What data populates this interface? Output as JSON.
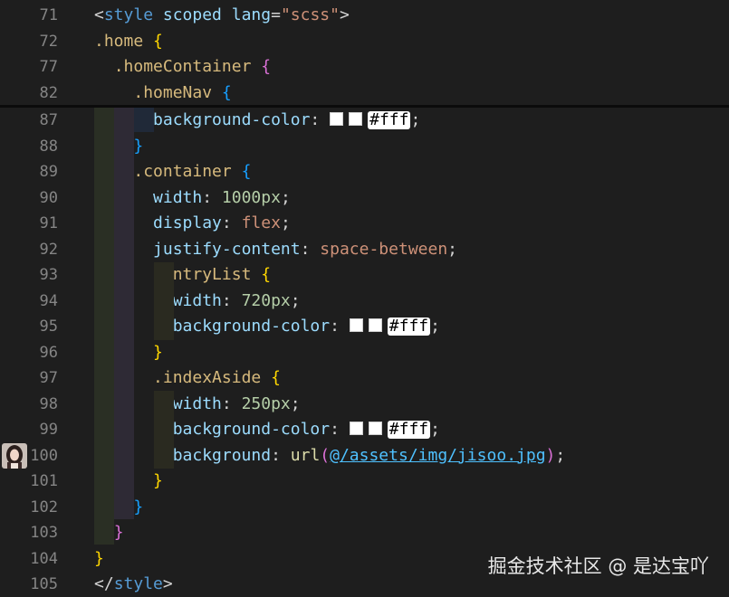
{
  "colors": {
    "background": "#1e1e1e",
    "line_number": "#858585",
    "tag": "#569cd6",
    "attribute": "#9cdcfe",
    "string": "#ce9178",
    "selector": "#d7ba7d",
    "brace_yellow": "#ffd700",
    "brace_purple": "#da70d6",
    "brace_blue": "#179fff",
    "number": "#b5cea8",
    "function": "#dcdcaa",
    "link": "#4fc1ff"
  },
  "sticky_scroll": {
    "lines": [
      {
        "number": "71",
        "segments": [
          {
            "text": "<",
            "cls": "punc"
          },
          {
            "text": "style",
            "cls": "tag"
          },
          {
            "text": " ",
            "cls": "punc"
          },
          {
            "text": "scoped",
            "cls": "attr"
          },
          {
            "text": " ",
            "cls": "punc"
          },
          {
            "text": "lang",
            "cls": "attr"
          },
          {
            "text": "=",
            "cls": "punc"
          },
          {
            "text": "\"scss\"",
            "cls": "str"
          },
          {
            "text": ">",
            "cls": "punc"
          }
        ]
      },
      {
        "number": "72",
        "segments": [
          {
            "text": ".home",
            "cls": "sel"
          },
          {
            "text": " ",
            "cls": "punc"
          },
          {
            "text": "{",
            "cls": "brace1"
          }
        ]
      },
      {
        "number": "77",
        "segments": [
          {
            "text": "  ",
            "cls": "punc"
          },
          {
            "text": ".homeContainer",
            "cls": "sel"
          },
          {
            "text": " ",
            "cls": "punc"
          },
          {
            "text": "{",
            "cls": "brace2"
          }
        ]
      },
      {
        "number": "82",
        "segments": [
          {
            "text": "    ",
            "cls": "punc"
          },
          {
            "text": ".homeNav",
            "cls": "sel"
          },
          {
            "text": " ",
            "cls": "punc"
          },
          {
            "text": "{",
            "cls": "brace3"
          }
        ]
      }
    ]
  },
  "code_lines": [
    {
      "number": "87",
      "segments": [
        {
          "text": "      ",
          "cls": "punc"
        },
        {
          "text": "background-color",
          "cls": "prop"
        },
        {
          "text": ": ",
          "cls": "punc"
        },
        {
          "swatch": true
        },
        {
          "swatch": true
        },
        {
          "hex": "#fff"
        },
        {
          "text": ";",
          "cls": "punc"
        }
      ]
    },
    {
      "number": "88",
      "segments": [
        {
          "text": "    ",
          "cls": "punc"
        },
        {
          "text": "}",
          "cls": "brace3"
        }
      ]
    },
    {
      "number": "89",
      "segments": [
        {
          "text": "    ",
          "cls": "punc"
        },
        {
          "text": ".container",
          "cls": "sel"
        },
        {
          "text": " ",
          "cls": "punc"
        },
        {
          "text": "{",
          "cls": "brace3"
        }
      ]
    },
    {
      "number": "90",
      "segments": [
        {
          "text": "      ",
          "cls": "punc"
        },
        {
          "text": "width",
          "cls": "prop"
        },
        {
          "text": ": ",
          "cls": "punc"
        },
        {
          "text": "1000px",
          "cls": "num"
        },
        {
          "text": ";",
          "cls": "punc"
        }
      ]
    },
    {
      "number": "91",
      "segments": [
        {
          "text": "      ",
          "cls": "punc"
        },
        {
          "text": "display",
          "cls": "prop"
        },
        {
          "text": ": ",
          "cls": "punc"
        },
        {
          "text": "flex",
          "cls": "val"
        },
        {
          "text": ";",
          "cls": "punc"
        }
      ]
    },
    {
      "number": "92",
      "segments": [
        {
          "text": "      ",
          "cls": "punc"
        },
        {
          "text": "justify-content",
          "cls": "prop"
        },
        {
          "text": ": ",
          "cls": "punc"
        },
        {
          "text": "space-between",
          "cls": "val"
        },
        {
          "text": ";",
          "cls": "punc"
        }
      ]
    },
    {
      "number": "93",
      "segments": [
        {
          "text": "      ",
          "cls": "punc"
        },
        {
          "text": ".entryList",
          "cls": "sel"
        },
        {
          "text": " ",
          "cls": "punc"
        },
        {
          "text": "{",
          "cls": "brace1"
        }
      ]
    },
    {
      "number": "94",
      "segments": [
        {
          "text": "        ",
          "cls": "punc"
        },
        {
          "text": "width",
          "cls": "prop"
        },
        {
          "text": ": ",
          "cls": "punc"
        },
        {
          "text": "720px",
          "cls": "num"
        },
        {
          "text": ";",
          "cls": "punc"
        }
      ]
    },
    {
      "number": "95",
      "segments": [
        {
          "text": "        ",
          "cls": "punc"
        },
        {
          "text": "background-color",
          "cls": "prop"
        },
        {
          "text": ": ",
          "cls": "punc"
        },
        {
          "swatch": true
        },
        {
          "swatch": true
        },
        {
          "hex": "#fff"
        },
        {
          "text": ";",
          "cls": "punc"
        }
      ]
    },
    {
      "number": "96",
      "segments": [
        {
          "text": "      ",
          "cls": "punc"
        },
        {
          "text": "}",
          "cls": "brace1"
        }
      ]
    },
    {
      "number": "97",
      "segments": [
        {
          "text": "      ",
          "cls": "punc"
        },
        {
          "text": ".indexAside",
          "cls": "sel"
        },
        {
          "text": " ",
          "cls": "punc"
        },
        {
          "text": "{",
          "cls": "brace1"
        }
      ]
    },
    {
      "number": "98",
      "segments": [
        {
          "text": "        ",
          "cls": "punc"
        },
        {
          "text": "width",
          "cls": "prop"
        },
        {
          "text": ": ",
          "cls": "punc"
        },
        {
          "text": "250px",
          "cls": "num"
        },
        {
          "text": ";",
          "cls": "punc"
        }
      ]
    },
    {
      "number": "99",
      "segments": [
        {
          "text": "        ",
          "cls": "punc"
        },
        {
          "text": "background-color",
          "cls": "prop"
        },
        {
          "text": ": ",
          "cls": "punc"
        },
        {
          "swatch": true
        },
        {
          "swatch": true
        },
        {
          "hex": "#fff"
        },
        {
          "text": ";",
          "cls": "punc"
        }
      ]
    },
    {
      "number": "100",
      "segments": [
        {
          "text": "        ",
          "cls": "punc"
        },
        {
          "text": "background",
          "cls": "prop"
        },
        {
          "text": ": ",
          "cls": "punc"
        },
        {
          "text": "url",
          "cls": "fn"
        },
        {
          "text": "(",
          "cls": "brace2"
        },
        {
          "text": "@/assets/img/jisoo.jpg",
          "cls": "url"
        },
        {
          "text": ")",
          "cls": "brace2"
        },
        {
          "text": ";",
          "cls": "punc"
        }
      ]
    },
    {
      "number": "101",
      "segments": [
        {
          "text": "      ",
          "cls": "punc"
        },
        {
          "text": "}",
          "cls": "brace1"
        }
      ]
    },
    {
      "number": "102",
      "segments": [
        {
          "text": "    ",
          "cls": "punc"
        },
        {
          "text": "}",
          "cls": "brace3"
        }
      ]
    },
    {
      "number": "103",
      "segments": [
        {
          "text": "  ",
          "cls": "punc"
        },
        {
          "text": "}",
          "cls": "brace2"
        }
      ]
    },
    {
      "number": "104",
      "segments": [
        {
          "text": "}",
          "cls": "brace1"
        }
      ]
    },
    {
      "number": "105",
      "segments": [
        {
          "text": "</",
          "cls": "punc"
        },
        {
          "text": "style",
          "cls": "tag"
        },
        {
          "text": ">",
          "cls": "punc"
        }
      ]
    }
  ],
  "watermark": "掘金技术社区 @ 是达宝吖",
  "avatar": {
    "icon": "user-avatar-icon"
  }
}
